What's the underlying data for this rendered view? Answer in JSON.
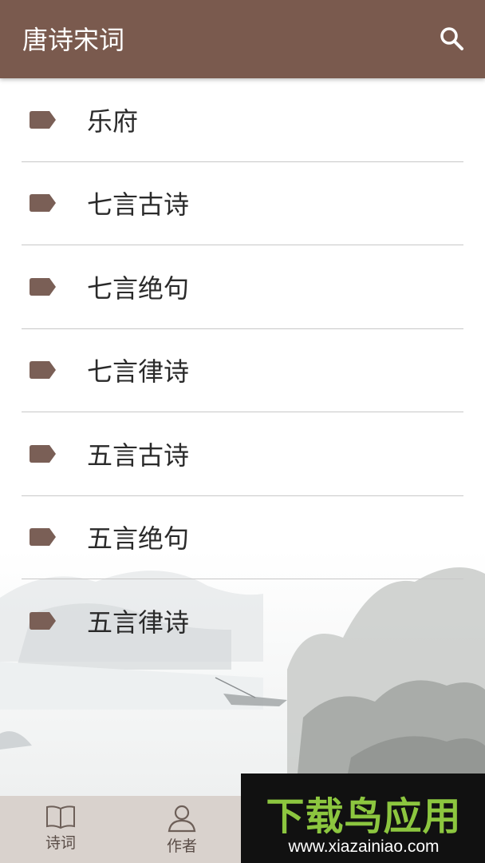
{
  "app": {
    "title": "唐诗宋词"
  },
  "header": {
    "search_icon": "search-icon"
  },
  "categories": [
    {
      "label": "乐府",
      "icon": "tag-icon"
    },
    {
      "label": "七言古诗",
      "icon": "tag-icon"
    },
    {
      "label": "七言绝句",
      "icon": "tag-icon"
    },
    {
      "label": "七言律诗",
      "icon": "tag-icon"
    },
    {
      "label": "五言古诗",
      "icon": "tag-icon"
    },
    {
      "label": "五言绝句",
      "icon": "tag-icon"
    },
    {
      "label": "五言律诗",
      "icon": "tag-icon"
    }
  ],
  "tabs": [
    {
      "label": "诗词",
      "icon": "book-icon"
    },
    {
      "label": "作者",
      "icon": "person-icon"
    }
  ],
  "watermark": {
    "title": "下载鸟应用",
    "url": "www.xiazainiao.com"
  },
  "colors": {
    "header": "#7a5a4e",
    "tag_icon": "#7a5f56",
    "tabbar": "#d9d2cd",
    "watermark_green": "#8cc63f"
  }
}
